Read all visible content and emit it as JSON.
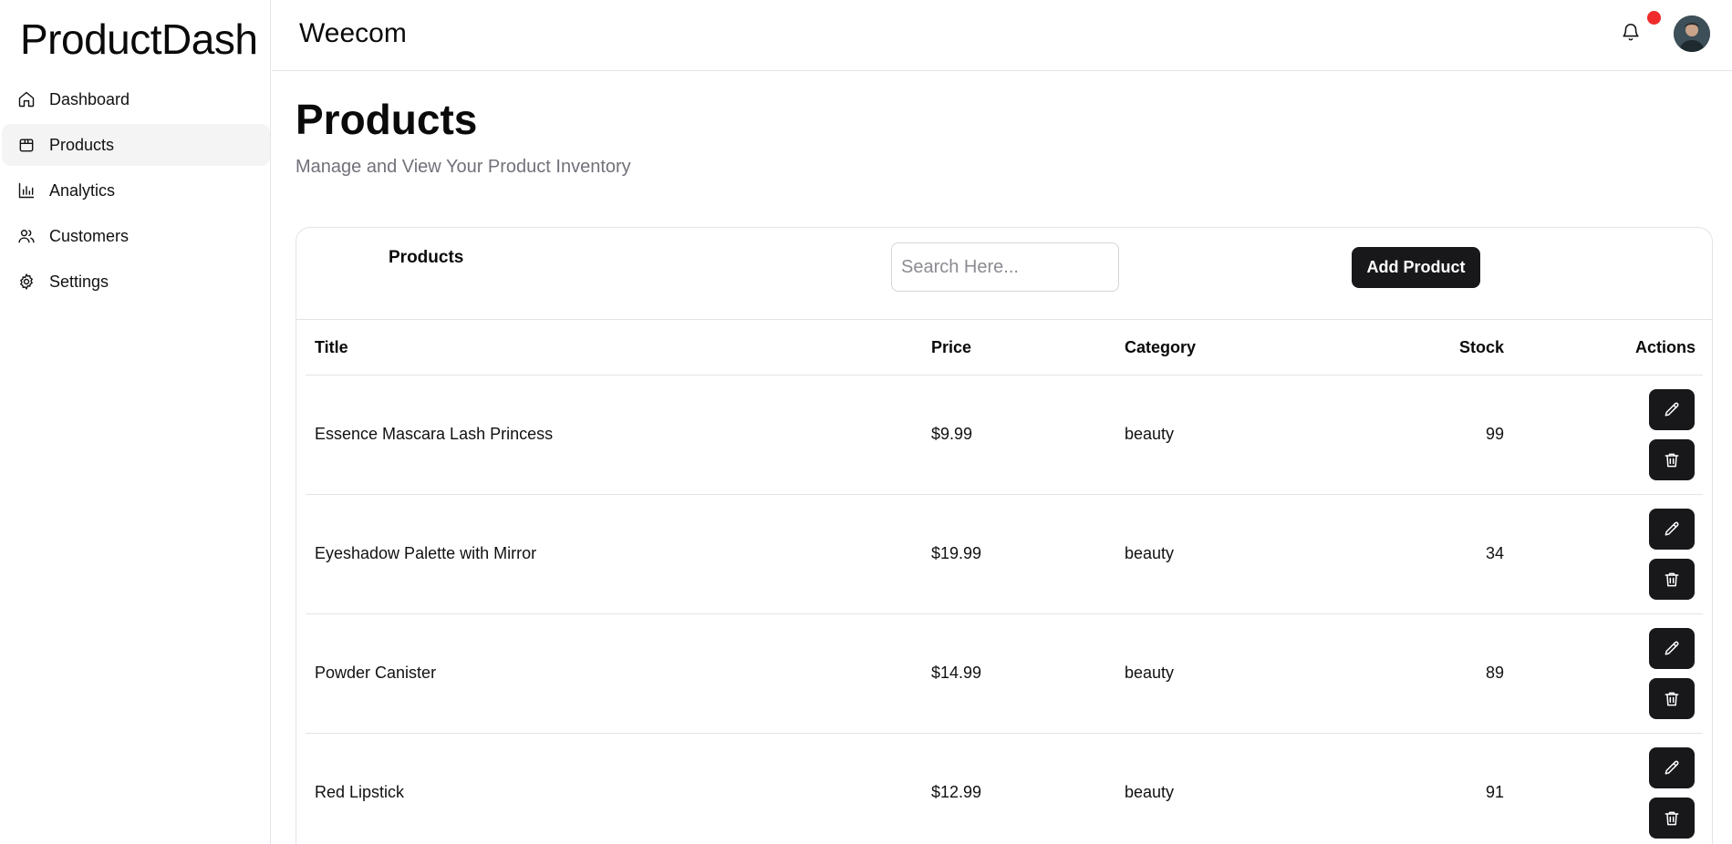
{
  "brand": "ProductDash",
  "sidebar": {
    "items": [
      {
        "label": "Dashboard",
        "icon": "home-icon"
      },
      {
        "label": "Products",
        "icon": "package-icon",
        "active": true
      },
      {
        "label": "Analytics",
        "icon": "bar-chart-icon"
      },
      {
        "label": "Customers",
        "icon": "users-icon"
      },
      {
        "label": "Settings",
        "icon": "gear-icon"
      }
    ]
  },
  "topbar": {
    "title": "Weecom",
    "notification_icon": "bell-icon",
    "notification_dot_color": "#ef2b2b"
  },
  "main": {
    "title": "Products",
    "subtitle": "Manage and View Your Product Inventory"
  },
  "card": {
    "title": "Products",
    "search_placeholder": "Search Here...",
    "add_button_label": "Add Product",
    "accent_color": "#18181b"
  },
  "table": {
    "headers": {
      "title": "Title",
      "price": "Price",
      "category": "Category",
      "stock": "Stock",
      "actions": "Actions"
    },
    "rows": [
      {
        "title": "Essence Mascara Lash Princess",
        "price": "$9.99",
        "category": "beauty",
        "stock": "99"
      },
      {
        "title": "Eyeshadow Palette with Mirror",
        "price": "$19.99",
        "category": "beauty",
        "stock": "34"
      },
      {
        "title": "Powder Canister",
        "price": "$14.99",
        "category": "beauty",
        "stock": "89"
      },
      {
        "title": "Red Lipstick",
        "price": "$12.99",
        "category": "beauty",
        "stock": "91"
      }
    ],
    "row_actions": [
      {
        "icon": "pencil-icon"
      },
      {
        "icon": "trash-icon"
      }
    ]
  }
}
